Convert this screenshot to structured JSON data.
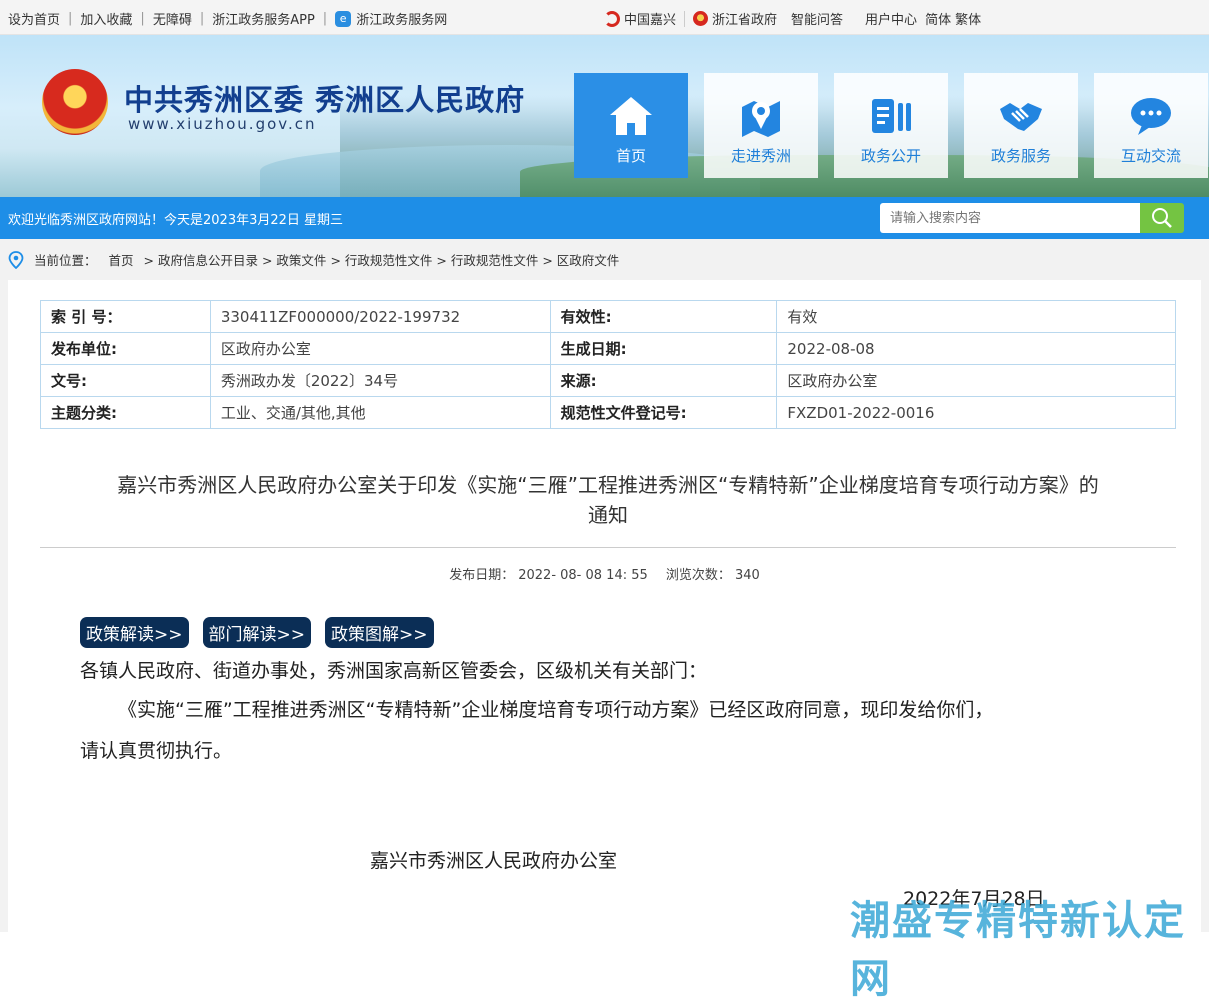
{
  "topbar": {
    "left_links": [
      "设为首页",
      "加入收藏",
      "无障碍",
      "浙江政务服务APP",
      "浙江政务服务网"
    ],
    "right_links": [
      "中国嘉兴",
      "浙江省政府",
      "智能问答",
      "用户中心",
      "简体",
      "繁体"
    ]
  },
  "header": {
    "title": "中共秀洲区委 秀洲区人民政府",
    "url": "www.xiuzhou.gov.cn",
    "nav": [
      {
        "label": "首页",
        "icon": "home-icon"
      },
      {
        "label": "走进秀洲",
        "icon": "map-pin-icon"
      },
      {
        "label": "政务公开",
        "icon": "document-icon"
      },
      {
        "label": "政务服务",
        "icon": "handshake-icon"
      },
      {
        "label": "互动交流",
        "icon": "chat-icon"
      }
    ]
  },
  "welcome": {
    "message": "欢迎光临秀洲区政府网站！今天是2023年3月22日 星期三",
    "search_placeholder": "请输入搜索内容"
  },
  "breadcrumb": {
    "prefix": "当前位置：",
    "items": [
      "首页",
      "> 政府信息公开目录",
      "> 政策文件",
      "> 行政规范性文件",
      "> 行政规范性文件",
      "> 区政府文件"
    ]
  },
  "info": {
    "rows": [
      [
        {
          "k": "索 引 号：",
          "v": "330411ZF000000/2022-199732"
        },
        {
          "k": "有效性:",
          "v": "有效"
        }
      ],
      [
        {
          "k": "发布单位:",
          "v": "区政府办公室"
        },
        {
          "k": "生成日期:",
          "v": "2022-08-08"
        }
      ],
      [
        {
          "k": "文号:",
          "v": "秀洲政办发〔2022〕34号"
        },
        {
          "k": "来源:",
          "v": "区政府办公室"
        }
      ],
      [
        {
          "k": "主题分类:",
          "v": "工业、交通/其他,其他"
        },
        {
          "k": "规范性文件登记号:",
          "v": "FXZD01-2022-0016"
        }
      ]
    ]
  },
  "document": {
    "title_line1": "嘉兴市秀洲区人民政府办公室关于印发《实施“三雁”工程推进秀洲区“专精特新”企业梯度培育专项行动方案》的",
    "title_line2": "通知",
    "publish_label": "发布日期：",
    "publish_date": "2022- 08- 08 14: 55",
    "views_label": "浏览次数：",
    "views": "340",
    "tags": [
      "政策解读>>",
      "部门解读>>",
      "政策图解>>"
    ],
    "recipients": "各镇人民政府、街道办事处，秀洲国家高新区管委会，区级机关有关部门：",
    "para_line1": "《实施“三雁”工程推进秀洲区“专精特新”企业梯度培育专项行动方案》已经区政府同意，现印发给你们，",
    "para_line2": "请认真贯彻执行。",
    "signature": "嘉兴市秀洲区人民政府办公室",
    "date": "2022年7月28日"
  },
  "watermark": "潮盛专精特新认定网",
  "colors": {
    "brand_blue": "#1e8ee7",
    "nav_active": "#2b8fe6",
    "title_blue": "#123f8f",
    "search_green": "#74c442",
    "tag_navy": "#0b2e56"
  }
}
